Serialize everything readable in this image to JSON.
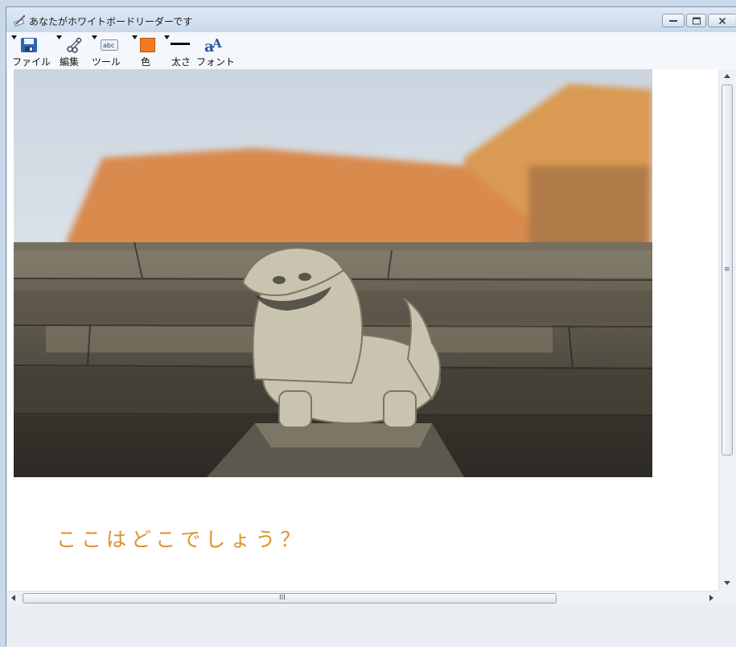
{
  "window": {
    "title": "あなたがホワイトボードリーダーです",
    "icons": {
      "app": "whiteboard-app-icon",
      "minimize": "minimize-icon",
      "maximize": "maximize-icon",
      "close": "close-icon"
    }
  },
  "toolbar": {
    "items": [
      {
        "label": "ファイル",
        "icon": "save-disk-icon"
      },
      {
        "label": "編集",
        "icon": "edit-tools-icon"
      },
      {
        "label": "ツール",
        "icon": "abc-text-tool-icon"
      },
      {
        "label": "色",
        "icon": "color-swatch-icon",
        "color": "#f47a20"
      },
      {
        "label": "太さ",
        "icon": "line-width-icon"
      },
      {
        "label": "フォント",
        "icon": "font-icon"
      }
    ]
  },
  "canvas": {
    "image": "shisa-lion-statue-photo",
    "text": "ここはどこでしょう？",
    "text_color": "#e0912c"
  },
  "scrollbars": {
    "horizontal_grip": "III",
    "vertical_grip": "≡"
  }
}
